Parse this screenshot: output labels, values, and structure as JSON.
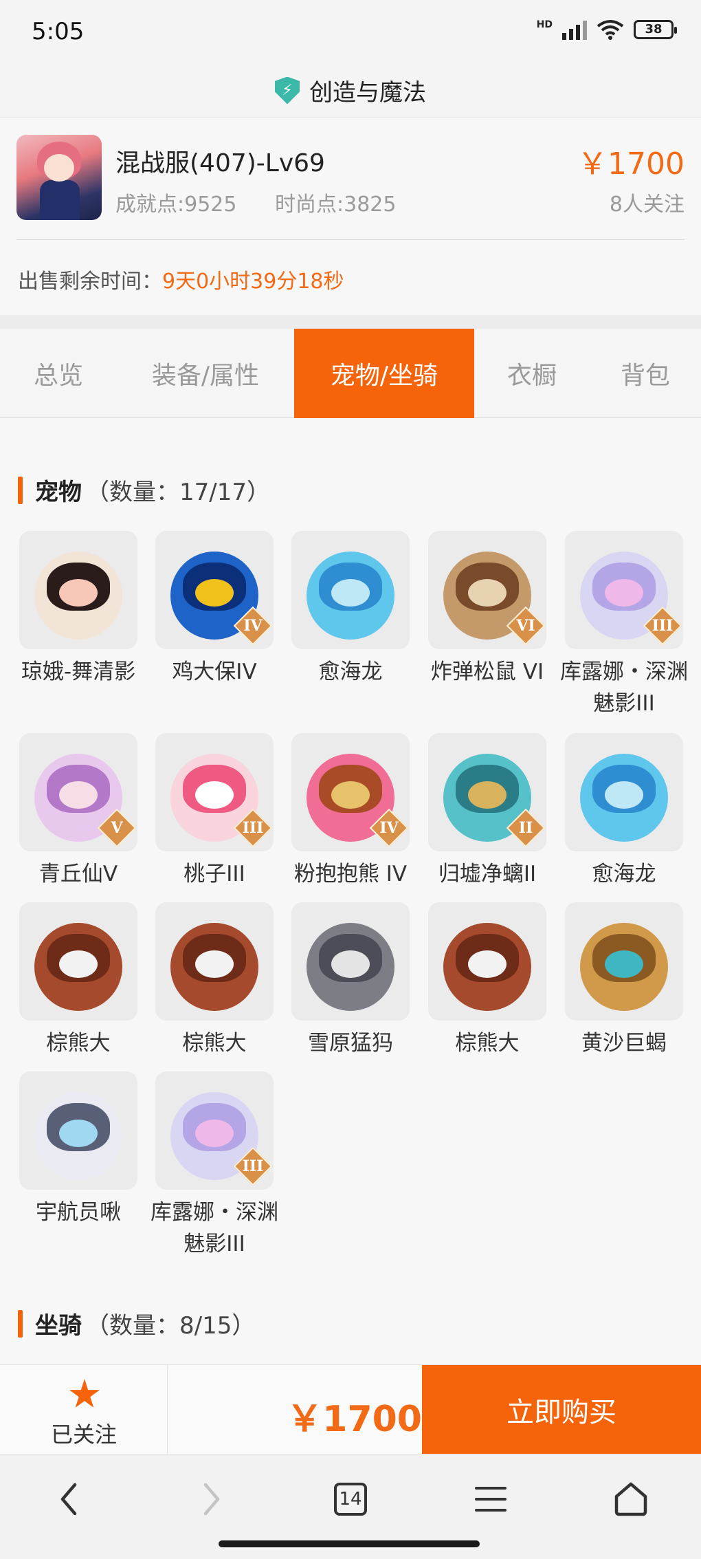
{
  "status_bar": {
    "time": "5:05",
    "hd": "HD",
    "battery": "38"
  },
  "title_bar": {
    "title": "创造与魔法",
    "shield_symbol": "⚡"
  },
  "account": {
    "server_name": "混战服(407)-Lv69",
    "achievement": "成就点:9525",
    "fashion": "时尚点:3825",
    "price": "￥1700",
    "followers": "8人关注",
    "sale_label": "出售剩余时间：",
    "sale_remaining": "9天0小时39分18秒"
  },
  "tabs": [
    "总览",
    "装备/属性",
    "宠物/坐骑",
    "衣橱",
    "背包"
  ],
  "active_tab": "宠物/坐骑",
  "pets_section": {
    "title": "宠物",
    "count": "（数量：17/17）"
  },
  "pets": [
    {
      "name": "琼娥-舞清影",
      "badge": "",
      "icon": "fairy-icon",
      "colors": [
        "#f3e4d8",
        "#2b1c1c",
        "#f7c8b8"
      ]
    },
    {
      "name": "鸡大保IV",
      "badge": "IV",
      "icon": "blue-bird-icon",
      "colors": [
        "#1e63c8",
        "#0b2f78",
        "#f2c21c"
      ]
    },
    {
      "name": "愈海龙",
      "badge": "",
      "icon": "sea-dragon-icon",
      "colors": [
        "#5fc7ec",
        "#2f8ed1",
        "#bfe8f7"
      ]
    },
    {
      "name": "炸弹松鼠 VI",
      "badge": "VI",
      "icon": "squirrel-icon",
      "colors": [
        "#c59a6a",
        "#7a4b2a",
        "#e7d2b2"
      ]
    },
    {
      "name": "库露娜・深渊魅影III",
      "badge": "III",
      "icon": "phantom-icon",
      "colors": [
        "#d8d6f2",
        "#b4a6e6",
        "#f0b8e8"
      ]
    },
    {
      "name": "青丘仙V",
      "badge": "V",
      "icon": "fox-fairy-icon",
      "colors": [
        "#e9c8ee",
        "#b478c8",
        "#f6dde6"
      ]
    },
    {
      "name": "桃子III",
      "badge": "III",
      "icon": "peach-cat-icon",
      "colors": [
        "#f9d4dc",
        "#ee5a82",
        "#ffffff"
      ]
    },
    {
      "name": "粉抱抱熊 IV",
      "badge": "IV",
      "icon": "pink-bear-icon",
      "colors": [
        "#f06d95",
        "#a94b26",
        "#e7c26a"
      ]
    },
    {
      "name": "归墟净螭II",
      "badge": "II",
      "icon": "jade-dragon-icon",
      "colors": [
        "#56c1c9",
        "#2a7c86",
        "#d8b25c"
      ]
    },
    {
      "name": "愈海龙",
      "badge": "",
      "icon": "sea-dragon-icon",
      "colors": [
        "#5fc7ec",
        "#2f8ed1",
        "#bfe8f7"
      ]
    },
    {
      "name": "棕熊大",
      "badge": "",
      "icon": "brown-bear-icon",
      "colors": [
        "#a54a2c",
        "#6e2c18",
        "#f2f2f2"
      ]
    },
    {
      "name": "棕熊大",
      "badge": "",
      "icon": "brown-bear-icon",
      "colors": [
        "#a54a2c",
        "#6e2c18",
        "#f2f2f2"
      ]
    },
    {
      "name": "雪原猛犸",
      "badge": "",
      "icon": "mammoth-icon",
      "colors": [
        "#7d7d86",
        "#4d4d58",
        "#e4e4e4"
      ]
    },
    {
      "name": "棕熊大",
      "badge": "",
      "icon": "brown-bear-icon",
      "colors": [
        "#a54a2c",
        "#6e2c18",
        "#f2f2f2"
      ]
    },
    {
      "name": "黄沙巨蝎",
      "badge": "",
      "icon": "scorpion-icon",
      "colors": [
        "#d09a4a",
        "#8a5a22",
        "#3fb7c2"
      ]
    },
    {
      "name": "宇航员啾",
      "badge": "",
      "icon": "astronaut-icon",
      "colors": [
        "#e9eaf2",
        "#5a5f78",
        "#9fd8f0"
      ]
    },
    {
      "name": "库露娜・深渊魅影III",
      "badge": "III",
      "icon": "phantom-icon",
      "colors": [
        "#d8d6f2",
        "#b4a6e6",
        "#f0b8e8"
      ]
    }
  ],
  "mounts_section": {
    "title": "坐骑",
    "count": "（数量：8/15）"
  },
  "bottom_bar": {
    "follow_label": "已关注",
    "price": "￥1700",
    "buy_label": "立即购买"
  },
  "browser": {
    "back": "‹",
    "forward": "›",
    "tab_count": "14"
  },
  "colors": {
    "accent": "#f5640a",
    "price": "#f26a15",
    "muted": "#9a9a9a"
  }
}
